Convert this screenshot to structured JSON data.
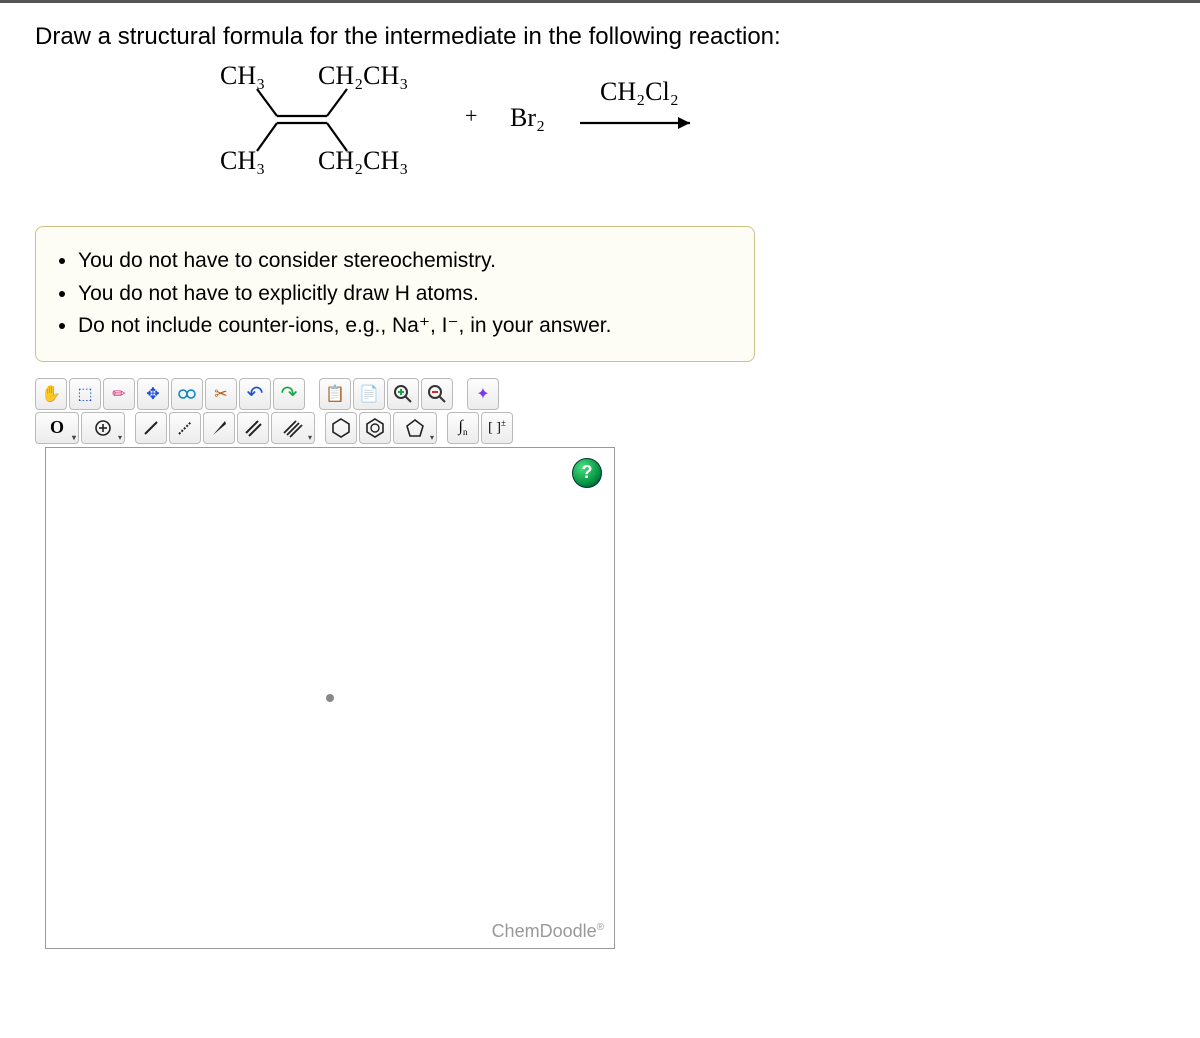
{
  "prompt": "Draw a structural formula for the intermediate in the following reaction:",
  "reaction": {
    "alkene_tl": "CH₃",
    "alkene_tr": "CH₂CH₃",
    "alkene_bl": "CH₃",
    "alkene_br": "CH₂CH₃",
    "plus": "+",
    "reagent": "Br₂",
    "solvent": "CH₂Cl₂"
  },
  "instructions": [
    "You do not have to consider stereochemistry.",
    "You do not have to explicitly draw H atoms.",
    "Do not include counter-ions, e.g., Na⁺, I⁻, in your answer."
  ],
  "toolbar": {
    "hand": "✋",
    "pointer": "⇱",
    "erase": "✏",
    "center": "⊕",
    "clean": "⚙",
    "cut": "✂",
    "undo": "↶",
    "redo": "↷",
    "copy": "📋",
    "paste": "📄",
    "zoomin": "🔍+",
    "zoomout": "🔍-",
    "settings": "⚗",
    "atom_o": "O",
    "atom_plus": "⊕",
    "bond_single": "/",
    "bond_rec": "⋰",
    "bond_wedge": "◣",
    "bond_dbl": "//",
    "bond_trp": "///",
    "ring6": "⬡",
    "ring6b": "⌬",
    "ring5": "⬠",
    "curve": "∫n",
    "charge": "[ ]±"
  },
  "canvas": {
    "help": "?",
    "brand": "ChemDoodle",
    "reg": "®"
  }
}
